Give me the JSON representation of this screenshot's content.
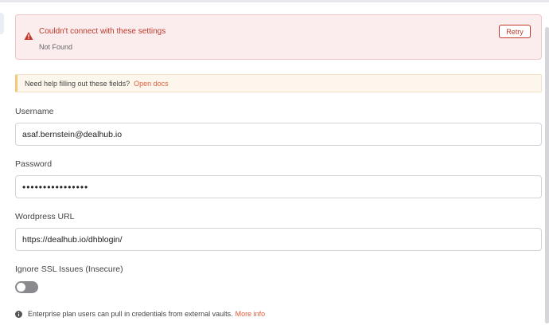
{
  "error": {
    "title": "Couldn't connect with these settings",
    "message": "Not Found",
    "retry_label": "Retry"
  },
  "help": {
    "text": "Need help filling out these fields?",
    "link": "Open docs"
  },
  "fields": {
    "username": {
      "label": "Username",
      "value": "asaf.bernstein@dealhub.io"
    },
    "password": {
      "label": "Password",
      "value": "••••••••••••••••"
    },
    "wordpress_url": {
      "label": "Wordpress URL",
      "value": "https://dealhub.io/dhblogin/"
    },
    "ignore_ssl": {
      "label": "Ignore SSL Issues (Insecure)",
      "enabled": false
    }
  },
  "footer": {
    "text": "Enterprise plan users can pull in credentials from external vaults.",
    "link": "More info"
  },
  "colors": {
    "error_accent": "#c0392b",
    "link_accent": "#e25c3b",
    "toggle_off": "#8a8a8e"
  },
  "icons": {
    "error": "warning-triangle-icon",
    "info": "info-circle-icon"
  }
}
